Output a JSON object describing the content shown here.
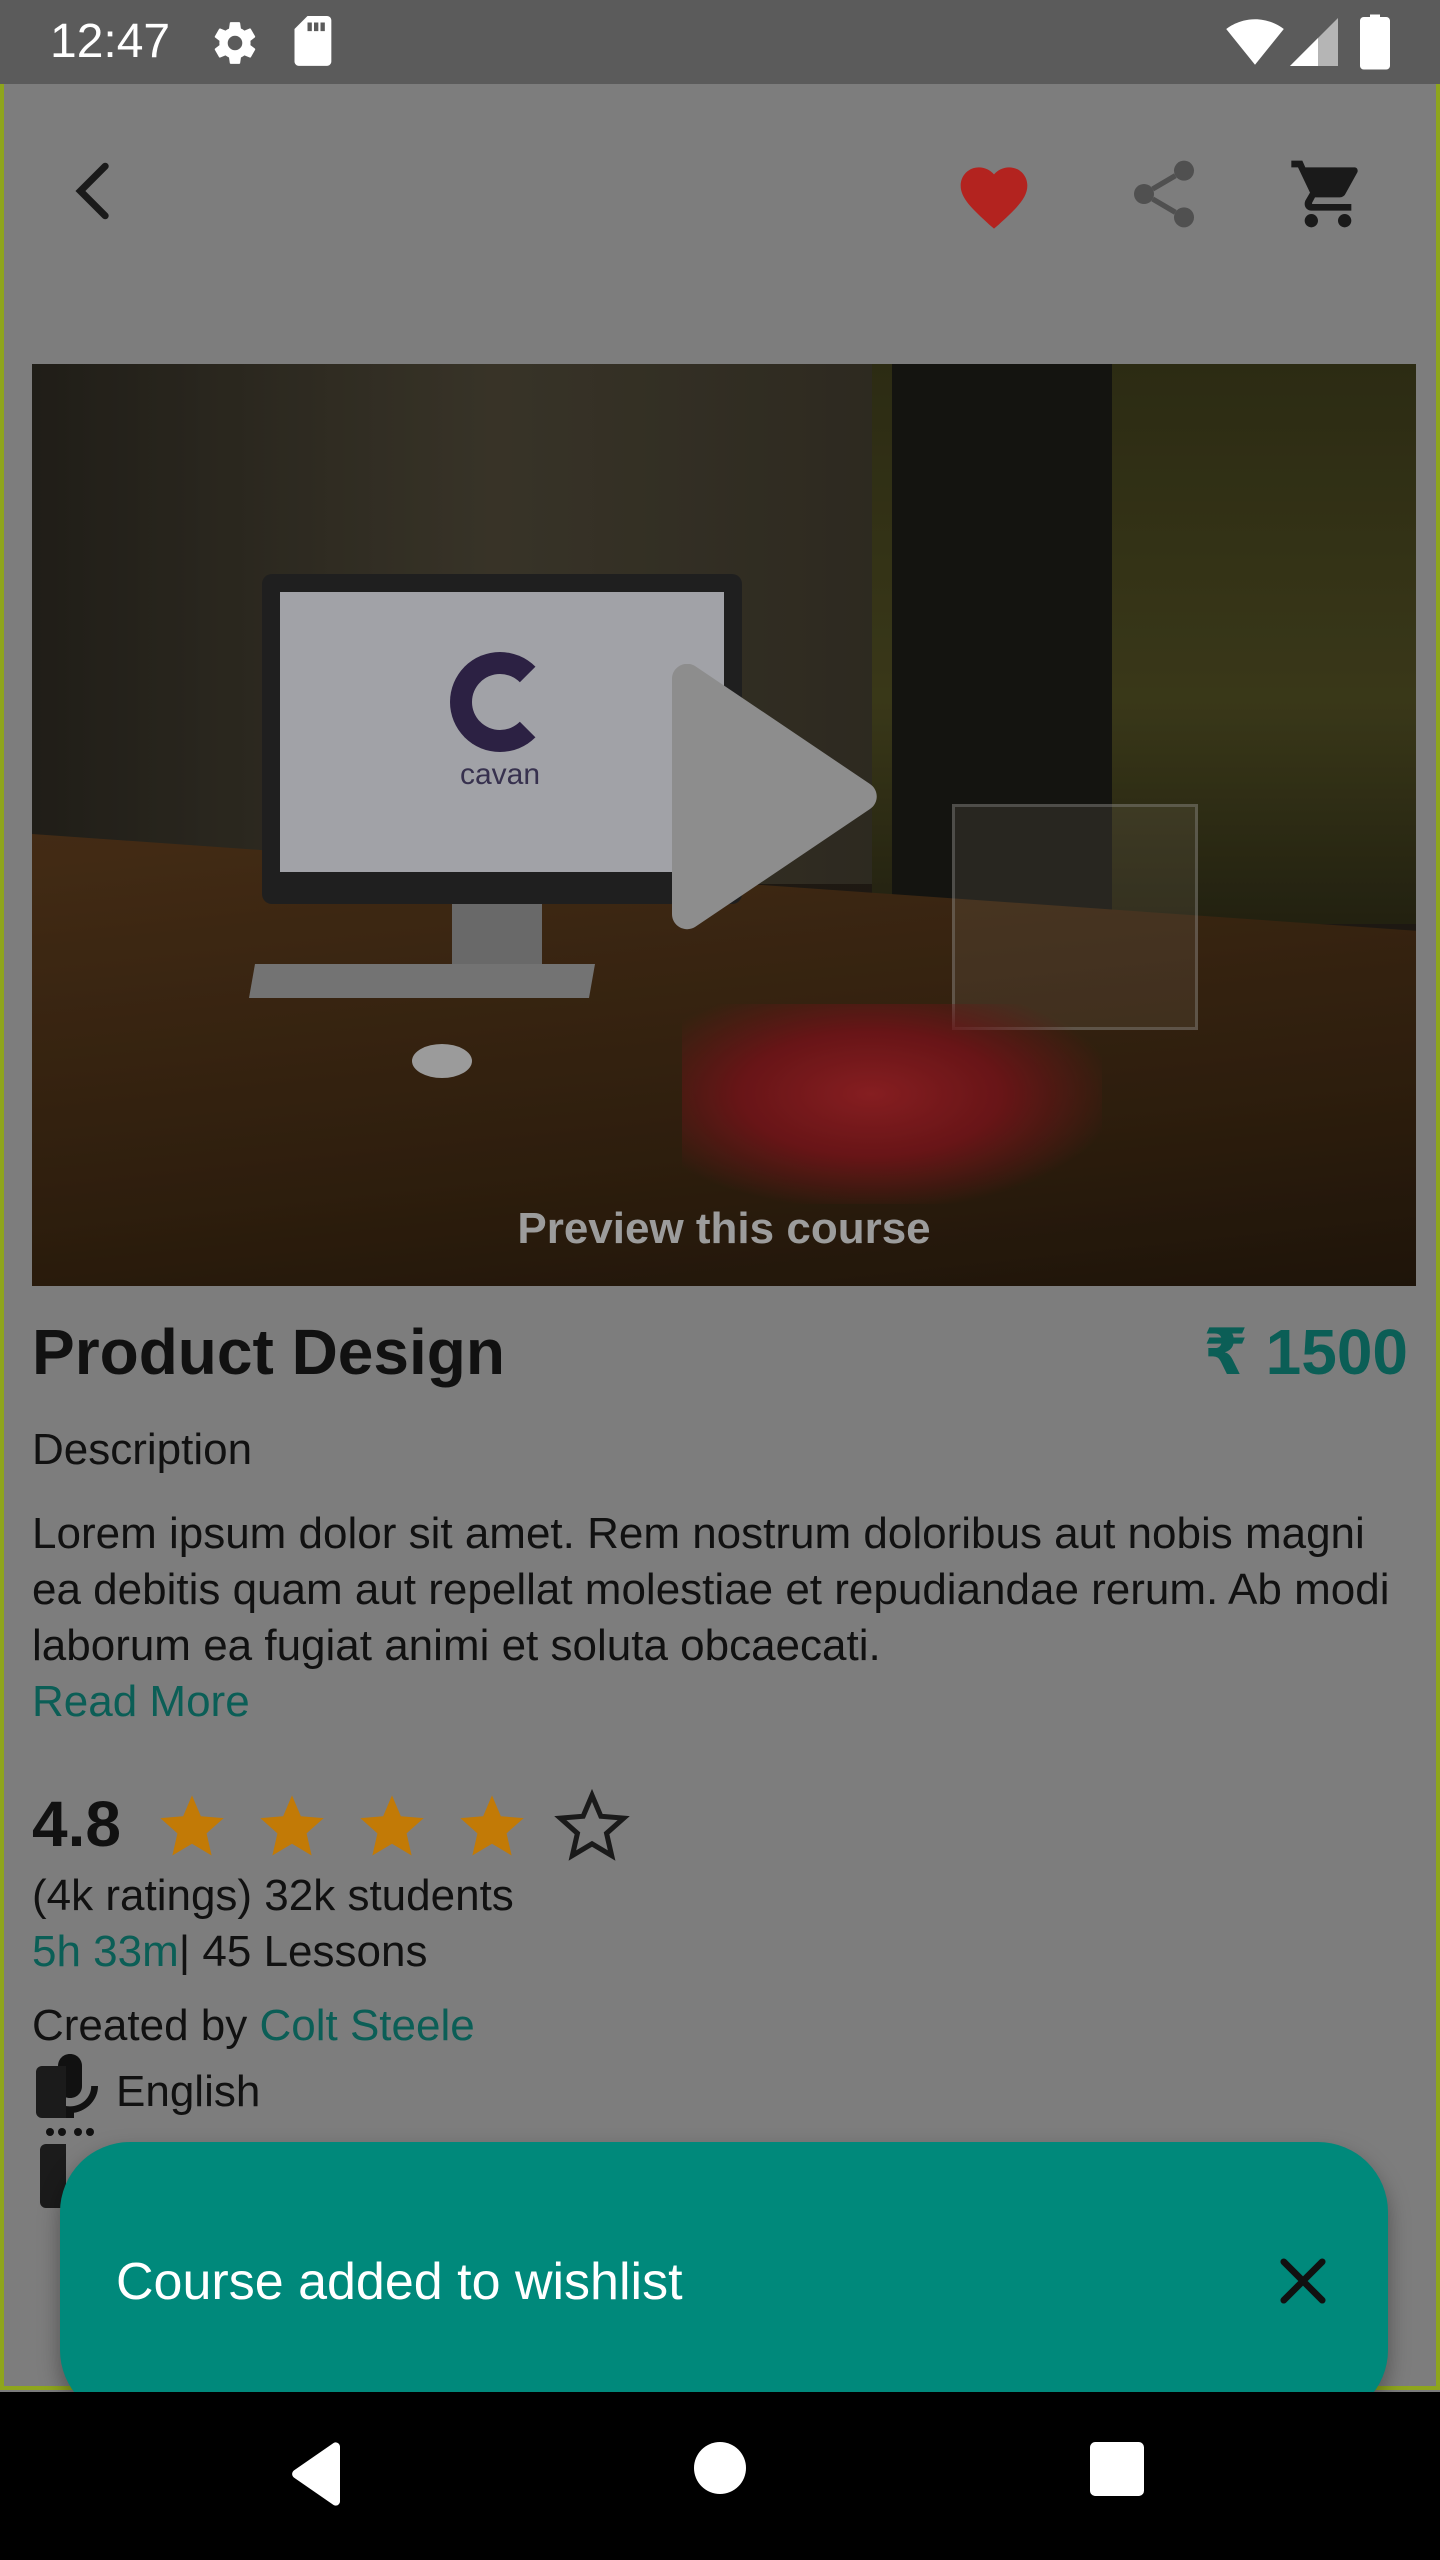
{
  "status_bar": {
    "time": "12:47",
    "icons": [
      "settings-icon",
      "sd-card-icon",
      "wifi-icon",
      "signal-icon",
      "battery-icon"
    ]
  },
  "toolbar": {
    "icons": [
      "back-arrow-icon",
      "heart-icon",
      "share-icon",
      "cart-icon"
    ],
    "heart_color": "#b3231f"
  },
  "hero": {
    "preview_label": "Preview this course",
    "play_icon": "play-icon"
  },
  "course": {
    "title": "Product Design",
    "price": "₹ 1500",
    "description_heading": "Description",
    "description": "Lorem ipsum dolor sit amet. Rem nostrum doloribus aut nobis magni ea debitis quam aut repellat molestiae et repudiandae rerum. Ab modi laborum ea fugiat animi et soluta obcaecati.",
    "read_more": "Read More",
    "rating": "4.8",
    "rating_stars_filled": 4,
    "rating_stars_total": 5,
    "ratings_students": "(4k ratings) 32k students",
    "duration": "5h 33m",
    "lessons": "| 45 Lessons",
    "created_by_label": "Created by",
    "author": "Colt Steele",
    "language": "English"
  },
  "snackbar": {
    "message": "Course added to wishlist",
    "close_icon": "close-icon"
  },
  "nav_bar": {
    "icons": [
      "nav-back-icon",
      "nav-home-icon",
      "nav-recents-icon"
    ]
  },
  "colors": {
    "accent": "#0b5e56",
    "snackbar": "#00897b",
    "star": "#c27a06"
  }
}
